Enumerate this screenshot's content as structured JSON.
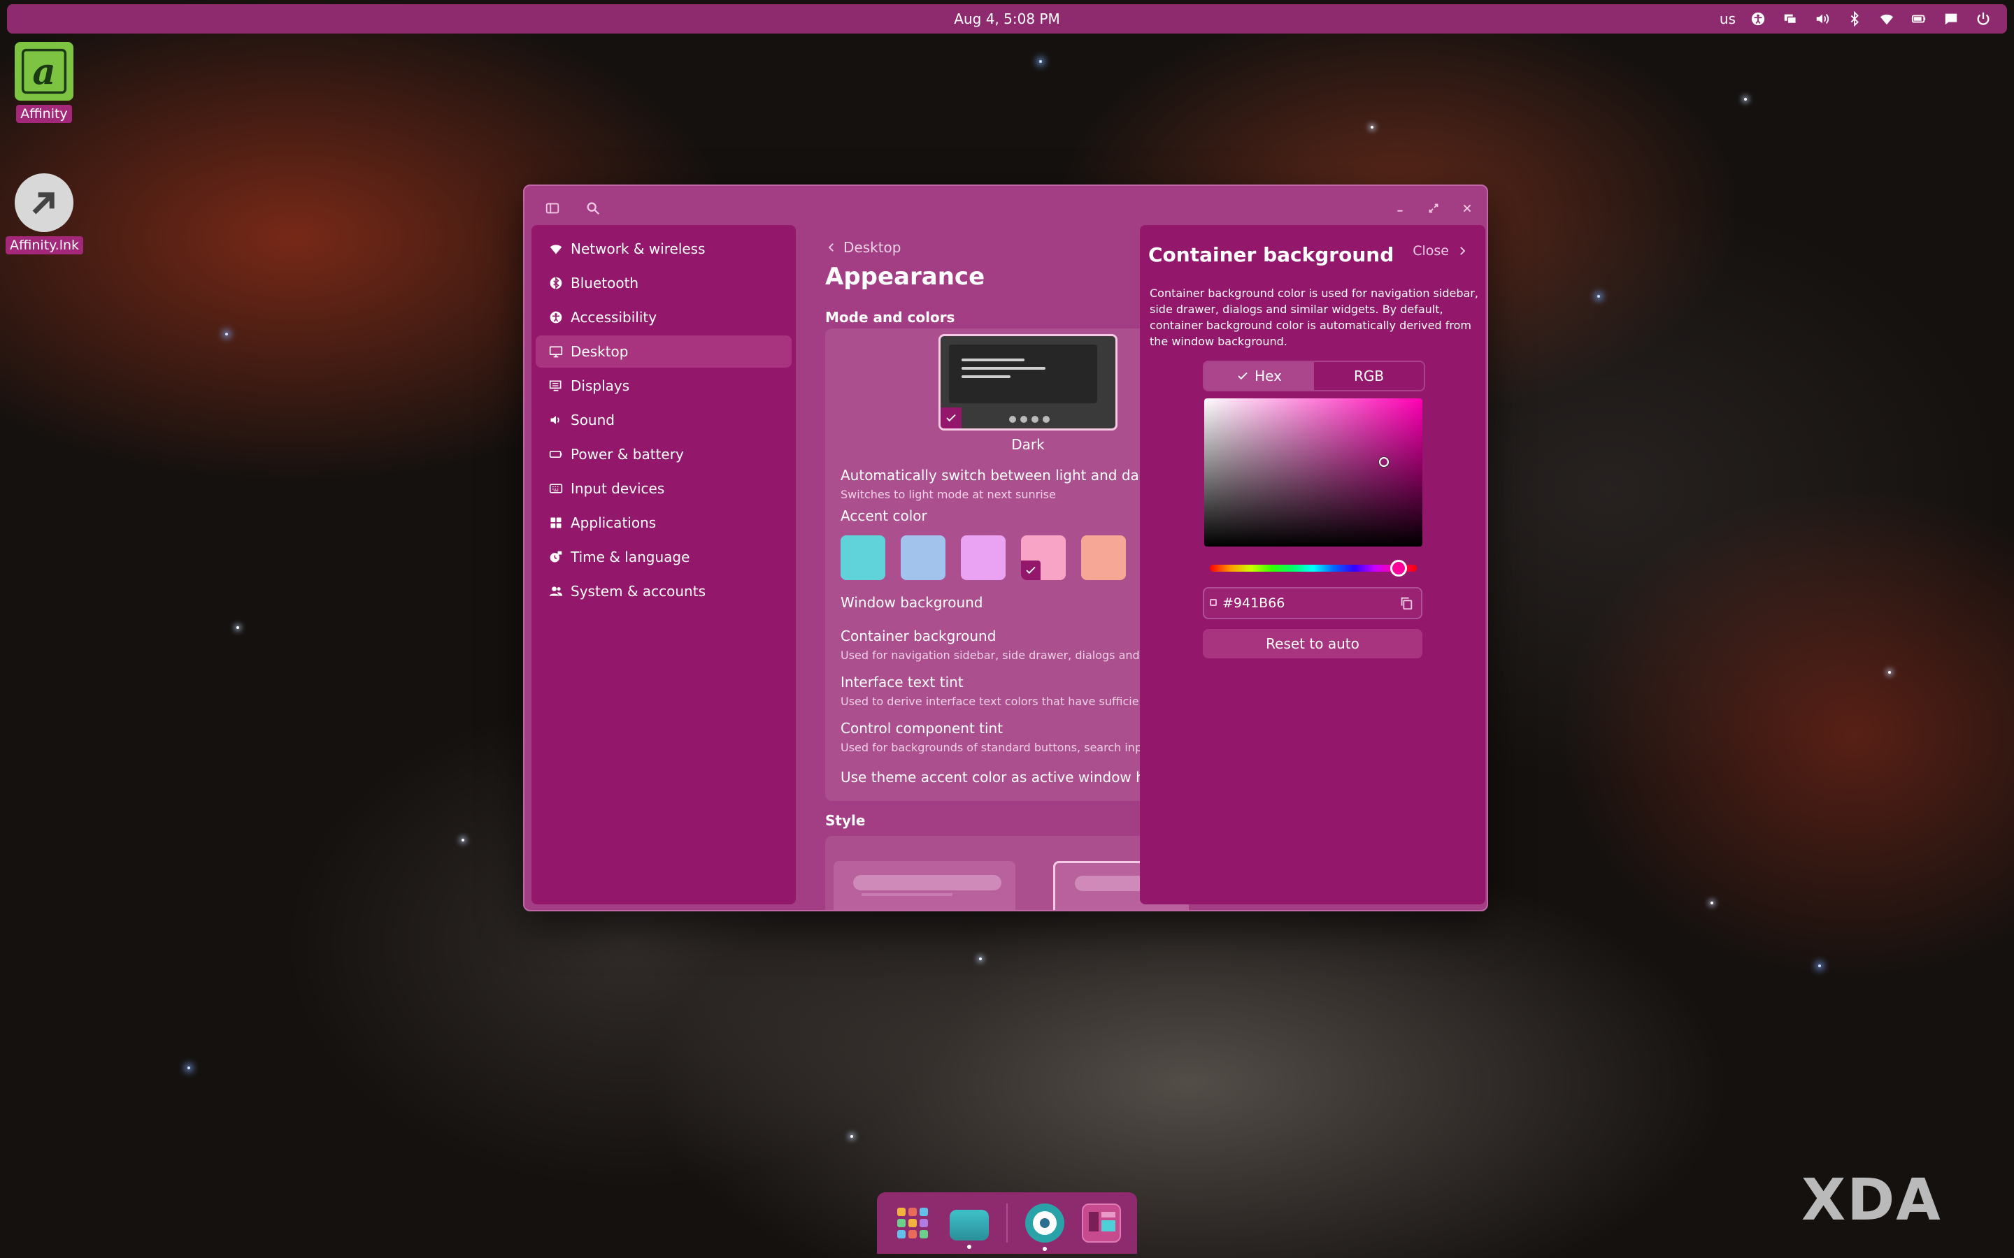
{
  "top_panel": {
    "clock": "Aug 4, 5:08 PM",
    "keyboard_layout": "us"
  },
  "desktop_icons": [
    {
      "label": "Affinity",
      "icon": "affinity-app-icon"
    },
    {
      "label": "Affinity.lnk",
      "icon": "shortcut-arrow-icon"
    }
  ],
  "sidebar": {
    "items": [
      {
        "label": "Network & wireless",
        "icon": "wifi-icon"
      },
      {
        "label": "Bluetooth",
        "icon": "bluetooth-icon"
      },
      {
        "label": "Accessibility",
        "icon": "accessibility-icon"
      },
      {
        "label": "Desktop",
        "icon": "desktop-icon",
        "active": true
      },
      {
        "label": "Displays",
        "icon": "displays-icon"
      },
      {
        "label": "Sound",
        "icon": "sound-icon"
      },
      {
        "label": "Power & battery",
        "icon": "battery-icon"
      },
      {
        "label": "Input devices",
        "icon": "keyboard-icon"
      },
      {
        "label": "Applications",
        "icon": "apps-grid-icon"
      },
      {
        "label": "Time & language",
        "icon": "time-language-icon"
      },
      {
        "label": "System & accounts",
        "icon": "accounts-icon"
      }
    ]
  },
  "content": {
    "breadcrumb": "Desktop",
    "title": "Appearance",
    "mode_section_title": "Mode and colors",
    "mode_label": "Dark",
    "auto_switch_title": "Automatically switch between light and dark mo",
    "auto_switch_sub": "Switches to light mode at next sunrise",
    "accent_title": "Accent color",
    "accent_colors": [
      "#5fd3d9",
      "#a2c3ec",
      "#eaa2f3",
      "#f7a4c6",
      "#f6a796"
    ],
    "accent_selected": 3,
    "window_background": "Window background",
    "container_background_title": "Container background",
    "container_background_sub": "Used for navigation sidebar, side drawer, dialogs and sir",
    "interface_text_title": "Interface text tint",
    "interface_text_sub": "Used to derive interface text colors that have sufficient c",
    "control_tint_title": "Control component tint",
    "control_tint_sub": "Used for backgrounds of standard buttons, search input",
    "active_hint_title": "Use theme accent color as active window hint",
    "style_section_title": "Style"
  },
  "drawer": {
    "title": "Container background",
    "close_label": "Close",
    "description": "Container background color is used for navigation sidebar, side drawer, dialogs and similar widgets. By default, container background color is automatically derived from the window background.",
    "tab_hex": "Hex",
    "tab_rgb": "RGB",
    "hex_value": "#941B66",
    "reset_label": "Reset to auto"
  },
  "colors": {
    "panel": "#8e2a6e",
    "window": "#a33d84",
    "container": "#93186b",
    "accent": "#f7a4c6"
  },
  "dock": {
    "apps": [
      "app-library-icon",
      "files-icon",
      "store-icon",
      "settings-icon"
    ]
  },
  "watermark": "XDA"
}
